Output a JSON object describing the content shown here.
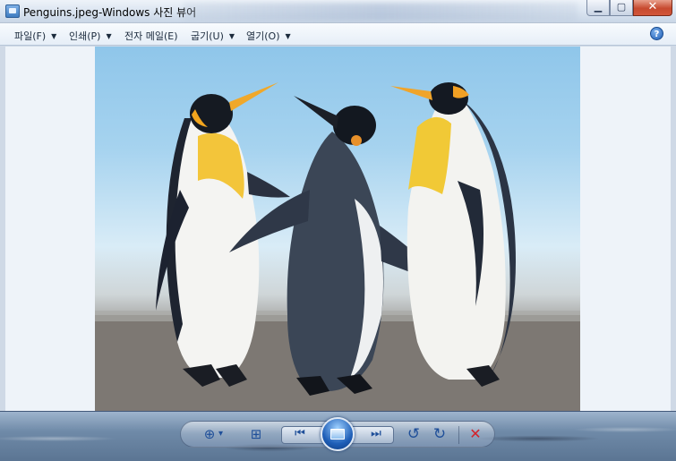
{
  "window": {
    "title": "Penguins.jpeg-Windows 사진 뷰어",
    "min_glyph": "▁",
    "max_glyph": "▢",
    "close_glyph": "✕"
  },
  "menu": {
    "items": [
      {
        "label": "파일(F)",
        "has_arrow": true
      },
      {
        "label": "인쇄(P)",
        "has_arrow": true
      },
      {
        "label": "전자 메일(E)",
        "has_arrow": false
      },
      {
        "label": "굽기(U)",
        "has_arrow": true
      },
      {
        "label": "열기(O)",
        "has_arrow": true
      }
    ],
    "arrow_glyph": "▼",
    "help_glyph": "?"
  },
  "viewer": {
    "image_subject": "penguins-photo"
  },
  "controls": {
    "zoom_glyph": "⊕",
    "zoom_arrow": "▾",
    "fit_glyph": "⊞",
    "prev_glyph": "⏮",
    "next_glyph": "⏭",
    "rotate_ccw_glyph": "↺",
    "rotate_cw_glyph": "↻",
    "delete_glyph": "✕"
  },
  "colors": {
    "accent": "#1f5fb8",
    "delete_red": "#d3222a"
  }
}
